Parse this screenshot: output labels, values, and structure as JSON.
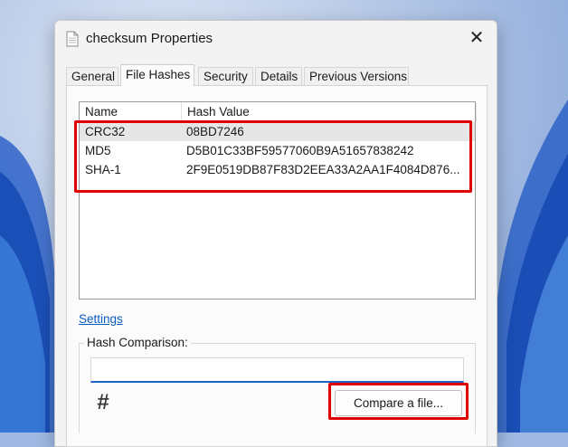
{
  "window": {
    "title": "checksum Properties",
    "close_symbol": "✕"
  },
  "tabs": [
    {
      "label": "General",
      "active": false
    },
    {
      "label": "File Hashes",
      "active": true
    },
    {
      "label": "Security",
      "active": false
    },
    {
      "label": "Details",
      "active": false
    },
    {
      "label": "Previous Versions",
      "active": false
    }
  ],
  "hash_list": {
    "columns": [
      "Name",
      "Hash Value"
    ],
    "rows": [
      {
        "name": "CRC32",
        "value": "08BD7246",
        "selected": true
      },
      {
        "name": "MD5",
        "value": "D5B01C33BF59577060B9A51657838242",
        "selected": false
      },
      {
        "name": "SHA-1",
        "value": "2F9E0519DB87F83D2EEA33A2AA1F4084D876...",
        "selected": false
      }
    ]
  },
  "settings_link": "Settings",
  "hash_comparison": {
    "label": "Hash Comparison:",
    "input_value": "",
    "icon": "hash-icon",
    "compare_button": "Compare a file..."
  },
  "colors": {
    "highlight": "#e00000",
    "link": "#0a5cc2",
    "input_accent": "#2062c0"
  }
}
